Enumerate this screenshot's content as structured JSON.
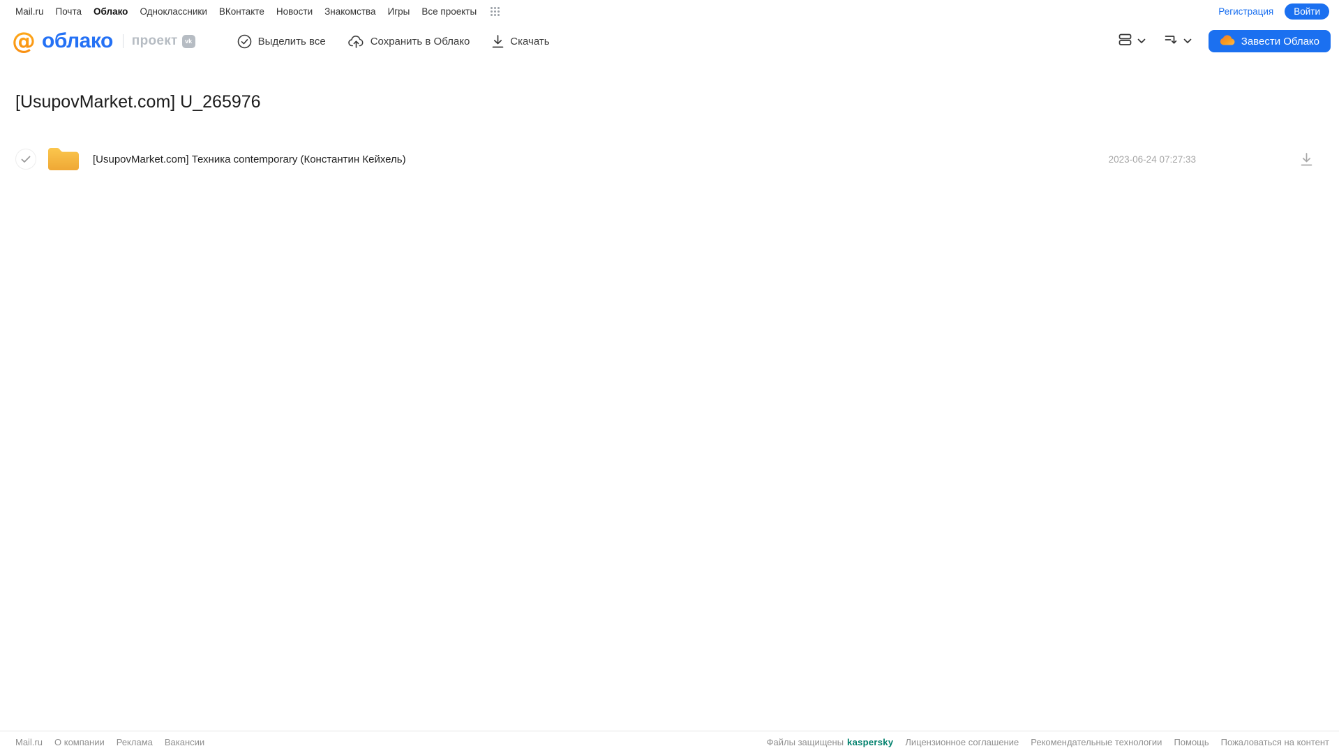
{
  "topnav": {
    "links": [
      "Mail.ru",
      "Почта",
      "Облако",
      "Одноклассники",
      "ВКонтакте",
      "Новости",
      "Знакомства",
      "Игры",
      "Все проекты"
    ],
    "registration_label": "Регистрация",
    "login_label": "Войти"
  },
  "header": {
    "logo_text": "облако",
    "logo_at": "@",
    "project_label": "проект",
    "vk_badge": "vk",
    "toolbar": {
      "select_all": "Выделить все",
      "save_to_cloud": "Сохранить в Облако",
      "download": "Скачать"
    },
    "cta_label": "Завести Облако"
  },
  "main": {
    "title": "[UsupovMarket.com] U_265976",
    "files": [
      {
        "name": "[UsupovMarket.com] Техника contemporary (Константин Кейхель)",
        "date": "2023-06-24 07:27:33"
      }
    ]
  },
  "footer": {
    "left_links": [
      "Mail.ru",
      "О компании",
      "Реклама",
      "Вакансии"
    ],
    "protected_label": "Файлы защищены",
    "kaspersky_label": "kaspersky",
    "right_links": [
      "Лицензионное соглашение",
      "Рекомендательные технологии",
      "Помощь",
      "Пожаловаться на контент"
    ]
  },
  "colors": {
    "accent_blue": "#1B70F0",
    "logo_blue": "#2471F5",
    "logo_orange": "#F89C1C",
    "folder_amber": "#F5B03C",
    "kaspersky_teal": "#00806C"
  }
}
